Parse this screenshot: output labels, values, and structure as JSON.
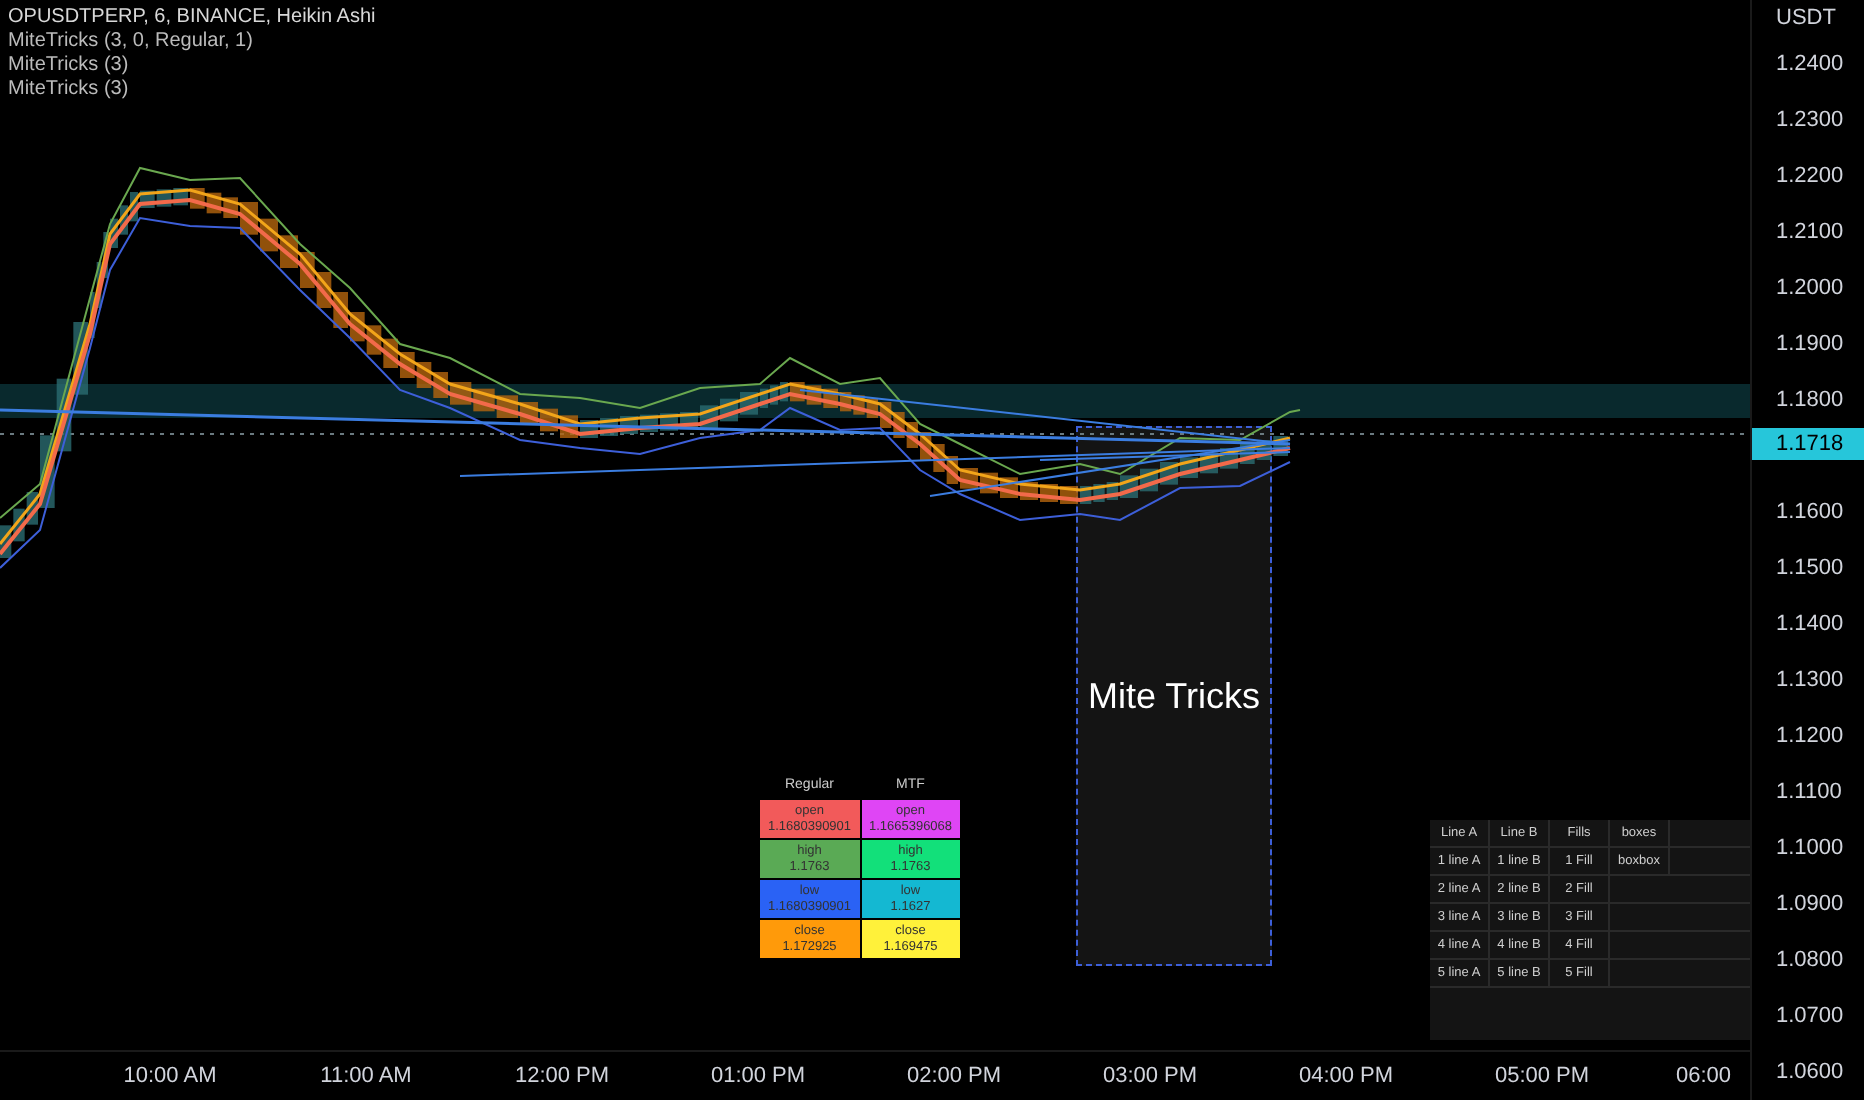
{
  "legend": {
    "title": "OPUSDTPERP, 6, BINANCE, Heikin Ashi",
    "indicators": [
      "MiteTricks (3, 0, Regular, 1)",
      "MiteTricks (3)",
      "MiteTricks (3)"
    ]
  },
  "price_axis": {
    "currency": "USDT",
    "ticks_above": [
      "1.2400",
      "1.2300",
      "1.2200",
      "1.2100",
      "1.2000",
      "1.1900",
      "1.1800"
    ],
    "last_price": "1.1718",
    "ticks_below": [
      "1.1600",
      "1.1500",
      "1.1400",
      "1.1300",
      "1.1200",
      "1.1100",
      "1.1000",
      "1.0900",
      "1.0800",
      "1.0700",
      "1.0600"
    ]
  },
  "time_axis": [
    "10:00 AM",
    "11:00 AM",
    "12:00 PM",
    "01:00 PM",
    "02:00 PM",
    "03:00 PM",
    "04:00 PM",
    "05:00 PM",
    "06:00"
  ],
  "box_label": "Mite Tricks",
  "ohlc_table": {
    "headers": [
      "Regular",
      "MTF"
    ],
    "rows": [
      [
        {
          "label": "open",
          "value": "1.1680390901",
          "color": "#f25a5a"
        },
        {
          "label": "open",
          "value": "1.1665396068",
          "color": "#df45f5"
        }
      ],
      [
        {
          "label": "high",
          "value": "1.1763",
          "color": "#5aaa55"
        },
        {
          "label": "high",
          "value": "1.1763",
          "color": "#12e07a"
        }
      ],
      [
        {
          "label": "low",
          "value": "1.1680390901",
          "color": "#2a62f5"
        },
        {
          "label": "low",
          "value": "1.1627",
          "color": "#14b8d2"
        }
      ],
      [
        {
          "label": "close",
          "value": "1.172925",
          "color": "#ff9a0a"
        },
        {
          "label": "close",
          "value": "1.169475",
          "color": "#fff13a"
        }
      ]
    ]
  },
  "lines_table": {
    "columns": [
      "Line A",
      "Line B",
      "Fills",
      "boxes"
    ],
    "rows": [
      [
        "1 line A",
        "1 line B",
        "1 Fill",
        "boxbox"
      ],
      [
        "2 line A",
        "2 line B",
        "2 Fill"
      ],
      [
        "3 line A",
        "3 line B",
        "3 Fill"
      ],
      [
        "4 line A",
        "4 line B",
        "4 Fill"
      ],
      [
        "5 line A",
        "5 line B",
        "5 Fill"
      ]
    ]
  }
}
